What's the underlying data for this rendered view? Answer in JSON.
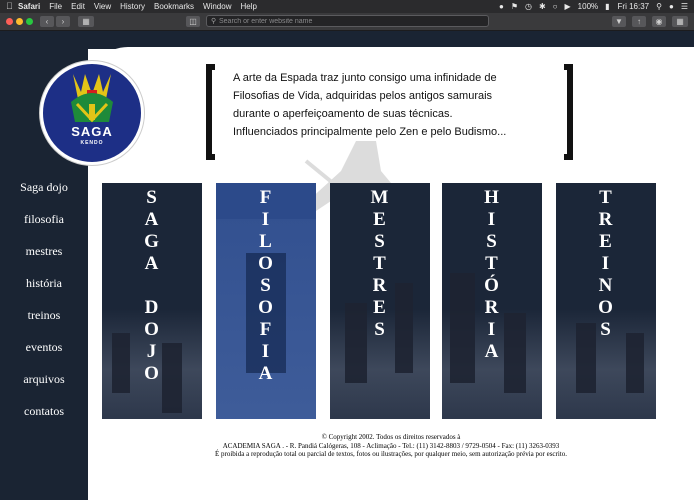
{
  "menubar": {
    "app": "Safari",
    "menus": [
      "File",
      "Edit",
      "View",
      "History",
      "Bookmarks",
      "Window",
      "Help"
    ],
    "battery": "100%",
    "clock": "Fri 16:37"
  },
  "toolbar": {
    "address_placeholder": "Search or enter website name"
  },
  "site": {
    "logo_text": "SAGA",
    "logo_sub": "KENDO",
    "nav": [
      "Saga dojo",
      "filosofia",
      "mestres",
      "história",
      "treinos",
      "eventos",
      "arquivos",
      "contatos"
    ],
    "quote_lines": [
      "A arte da Espada traz junto consigo uma infinidade de",
      "Filosofias de Vida, adquiridas pelos antigos samurais",
      "durante o aperfeiçoamento de suas técnicas.",
      "Influenciados principalmente pelo Zen e pelo Budismo..."
    ],
    "panels": [
      {
        "label": [
          "S",
          "A",
          "G",
          "A",
          " ",
          "D",
          "O",
          "J",
          "O"
        ]
      },
      {
        "label": [
          "F",
          "I",
          "L",
          "O",
          "S",
          "O",
          "F",
          "I",
          "A"
        ]
      },
      {
        "label": [
          "M",
          "E",
          "S",
          "T",
          "R",
          "E",
          "S"
        ]
      },
      {
        "label": [
          "H",
          "I",
          "S",
          "T",
          "Ó",
          "R",
          "I",
          "A"
        ]
      },
      {
        "label": [
          "T",
          "R",
          "E",
          "I",
          "N",
          "O",
          "S"
        ]
      }
    ],
    "footer_lines": [
      "© Copyright 2002. Todos os direitos reservados à",
      "ACADEMIA SAGA . - R. Pandiá Calógeras, 108 - Aclimação - Tel.: (11) 3142-8803 / 9729-0504 - Fax: (11) 3263-0393",
      "É proibida a reprodução total ou parcial de textos, fotos ou ilustrações, por qualquer meio, sem autorização prévia por escrito."
    ]
  },
  "colors": {
    "sidebar": "#1a2433",
    "panel": "#1b2638",
    "panel_highlight": "#2c4a8a",
    "logo_blue": "#1d2f86",
    "logo_gold": "#e3c417",
    "logo_green": "#1e8a3a",
    "logo_red": "#d21f1f"
  }
}
